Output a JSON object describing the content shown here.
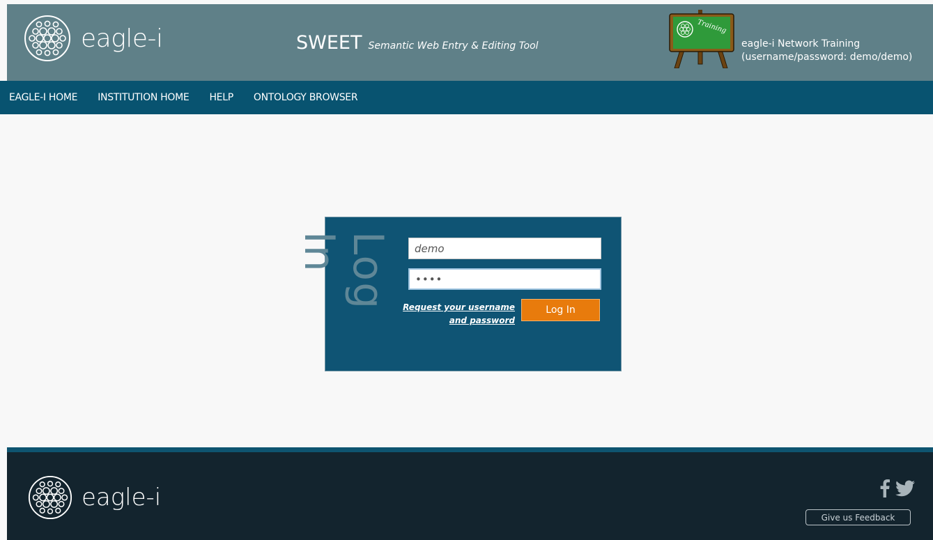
{
  "header": {
    "brand": "eagle-i",
    "app_name": "SWEET",
    "app_subtitle": "Semantic Web Entry & Editing Tool",
    "easel_label": "Training",
    "training_line1": "eagle-i Network Training",
    "training_line2": "(username/password: demo/demo)"
  },
  "nav": {
    "items": [
      "EAGLE-I HOME",
      "INSTITUTION HOME",
      "HELP",
      "ONTOLOGY BROWSER"
    ]
  },
  "login": {
    "title": "Log In",
    "username_value": "demo",
    "password_value": "••••",
    "request_link": "Request your username and password",
    "button_label": "Log In"
  },
  "footer": {
    "brand": "eagle-i",
    "facebook_icon": "facebook-icon",
    "twitter_icon": "twitter-icon",
    "feedback_label": "Give us Feedback"
  },
  "colors": {
    "header_bg": "#5f8088",
    "nav_bg": "#085370",
    "panel_bg": "#0f5474",
    "button_orange": "#e87b0c",
    "footer_bg": "#13242e",
    "page_bg": "#f8f8f8"
  }
}
